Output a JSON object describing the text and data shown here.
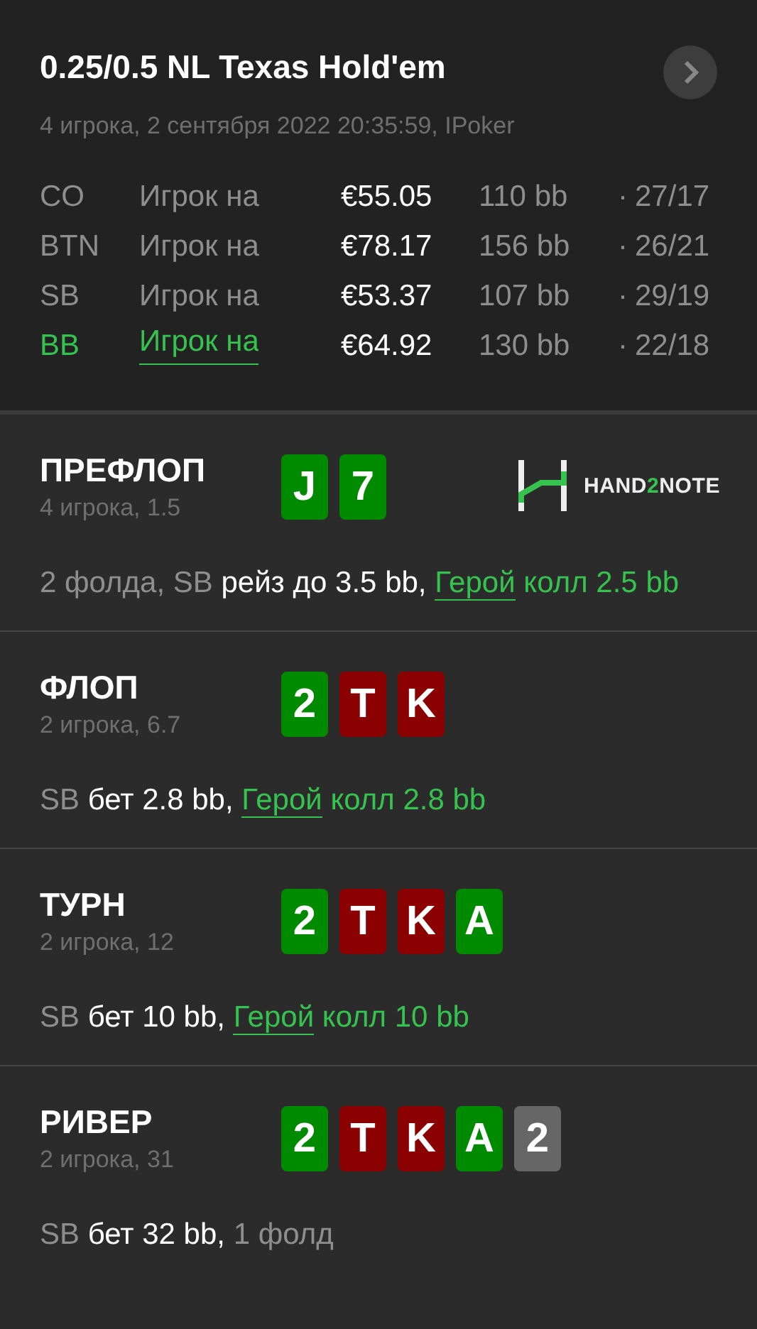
{
  "header": {
    "title": "0.25/0.5 NL Texas Hold'em",
    "subtitle": "4 игрока, 2 сентября 2022 20:35:59, IPoker"
  },
  "players": [
    {
      "position": "CO",
      "name": "Игрок на",
      "stack": "€55.05",
      "bb": "110 bb",
      "sep": "·",
      "stats": "27/17",
      "hero": false
    },
    {
      "position": "BTN",
      "name": "Игрок на",
      "stack": "€78.17",
      "bb": "156 bb",
      "sep": "·",
      "stats": "26/21",
      "hero": false
    },
    {
      "position": "SB",
      "name": "Игрок на",
      "stack": "€53.37",
      "bb": "107 bb",
      "sep": "·",
      "stats": "29/19",
      "hero": false
    },
    {
      "position": "BB",
      "name": "Игрок на",
      "stack": "€64.92",
      "bb": "130 bb",
      "sep": "·",
      "stats": "22/18",
      "hero": true
    }
  ],
  "streets": [
    {
      "title": "ПРЕФЛОП",
      "info": "4 игрока, 1.5",
      "logo": {
        "parts": [
          {
            "text": "HAND",
            "accent": false
          },
          {
            "text": "2",
            "accent": true
          },
          {
            "text": "NOTE",
            "accent": false
          }
        ]
      },
      "cards": [
        {
          "rank": "J",
          "color": "#008a00"
        },
        {
          "rank": "7",
          "color": "#008a00"
        }
      ],
      "action": [
        {
          "kind": "muted",
          "text": "2 фолда, SB "
        },
        {
          "kind": "normal",
          "text": "рейз до 3.5 bb, "
        },
        {
          "kind": "hero_link",
          "text": "Герой"
        },
        {
          "kind": "hero",
          "text": " колл 2.5 bb"
        }
      ]
    },
    {
      "title": "ФЛОП",
      "info": "2 игрока, 6.7",
      "cards": [
        {
          "rank": "2",
          "color": "#008a00"
        },
        {
          "rank": "T",
          "color": "#8b0000"
        },
        {
          "rank": "K",
          "color": "#8b0000"
        }
      ],
      "action": [
        {
          "kind": "muted",
          "text": "SB "
        },
        {
          "kind": "normal",
          "text": "бет 2.8 bb, "
        },
        {
          "kind": "hero_link",
          "text": "Герой"
        },
        {
          "kind": "hero",
          "text": " колл 2.8 bb"
        }
      ]
    },
    {
      "title": "ТУРН",
      "info": "2 игрока, 12",
      "cards": [
        {
          "rank": "2",
          "color": "#008a00"
        },
        {
          "rank": "T",
          "color": "#8b0000"
        },
        {
          "rank": "K",
          "color": "#8b0000"
        },
        {
          "rank": "A",
          "color": "#008a00"
        }
      ],
      "action": [
        {
          "kind": "muted",
          "text": "SB "
        },
        {
          "kind": "normal",
          "text": "бет 10 bb, "
        },
        {
          "kind": "hero_link",
          "text": "Герой"
        },
        {
          "kind": "hero",
          "text": " колл 10 bb"
        }
      ]
    },
    {
      "title": "РИВЕР",
      "info": "2 игрока, 31",
      "cards": [
        {
          "rank": "2",
          "color": "#008a00"
        },
        {
          "rank": "T",
          "color": "#8b0000"
        },
        {
          "rank": "K",
          "color": "#8b0000"
        },
        {
          "rank": "A",
          "color": "#008a00"
        },
        {
          "rank": "2",
          "color": "#666666"
        }
      ],
      "action": [
        {
          "kind": "muted",
          "text": "SB "
        },
        {
          "kind": "normal",
          "text": "бет 32 bb, "
        },
        {
          "kind": "muted",
          "text": "1 фолд"
        }
      ]
    }
  ]
}
